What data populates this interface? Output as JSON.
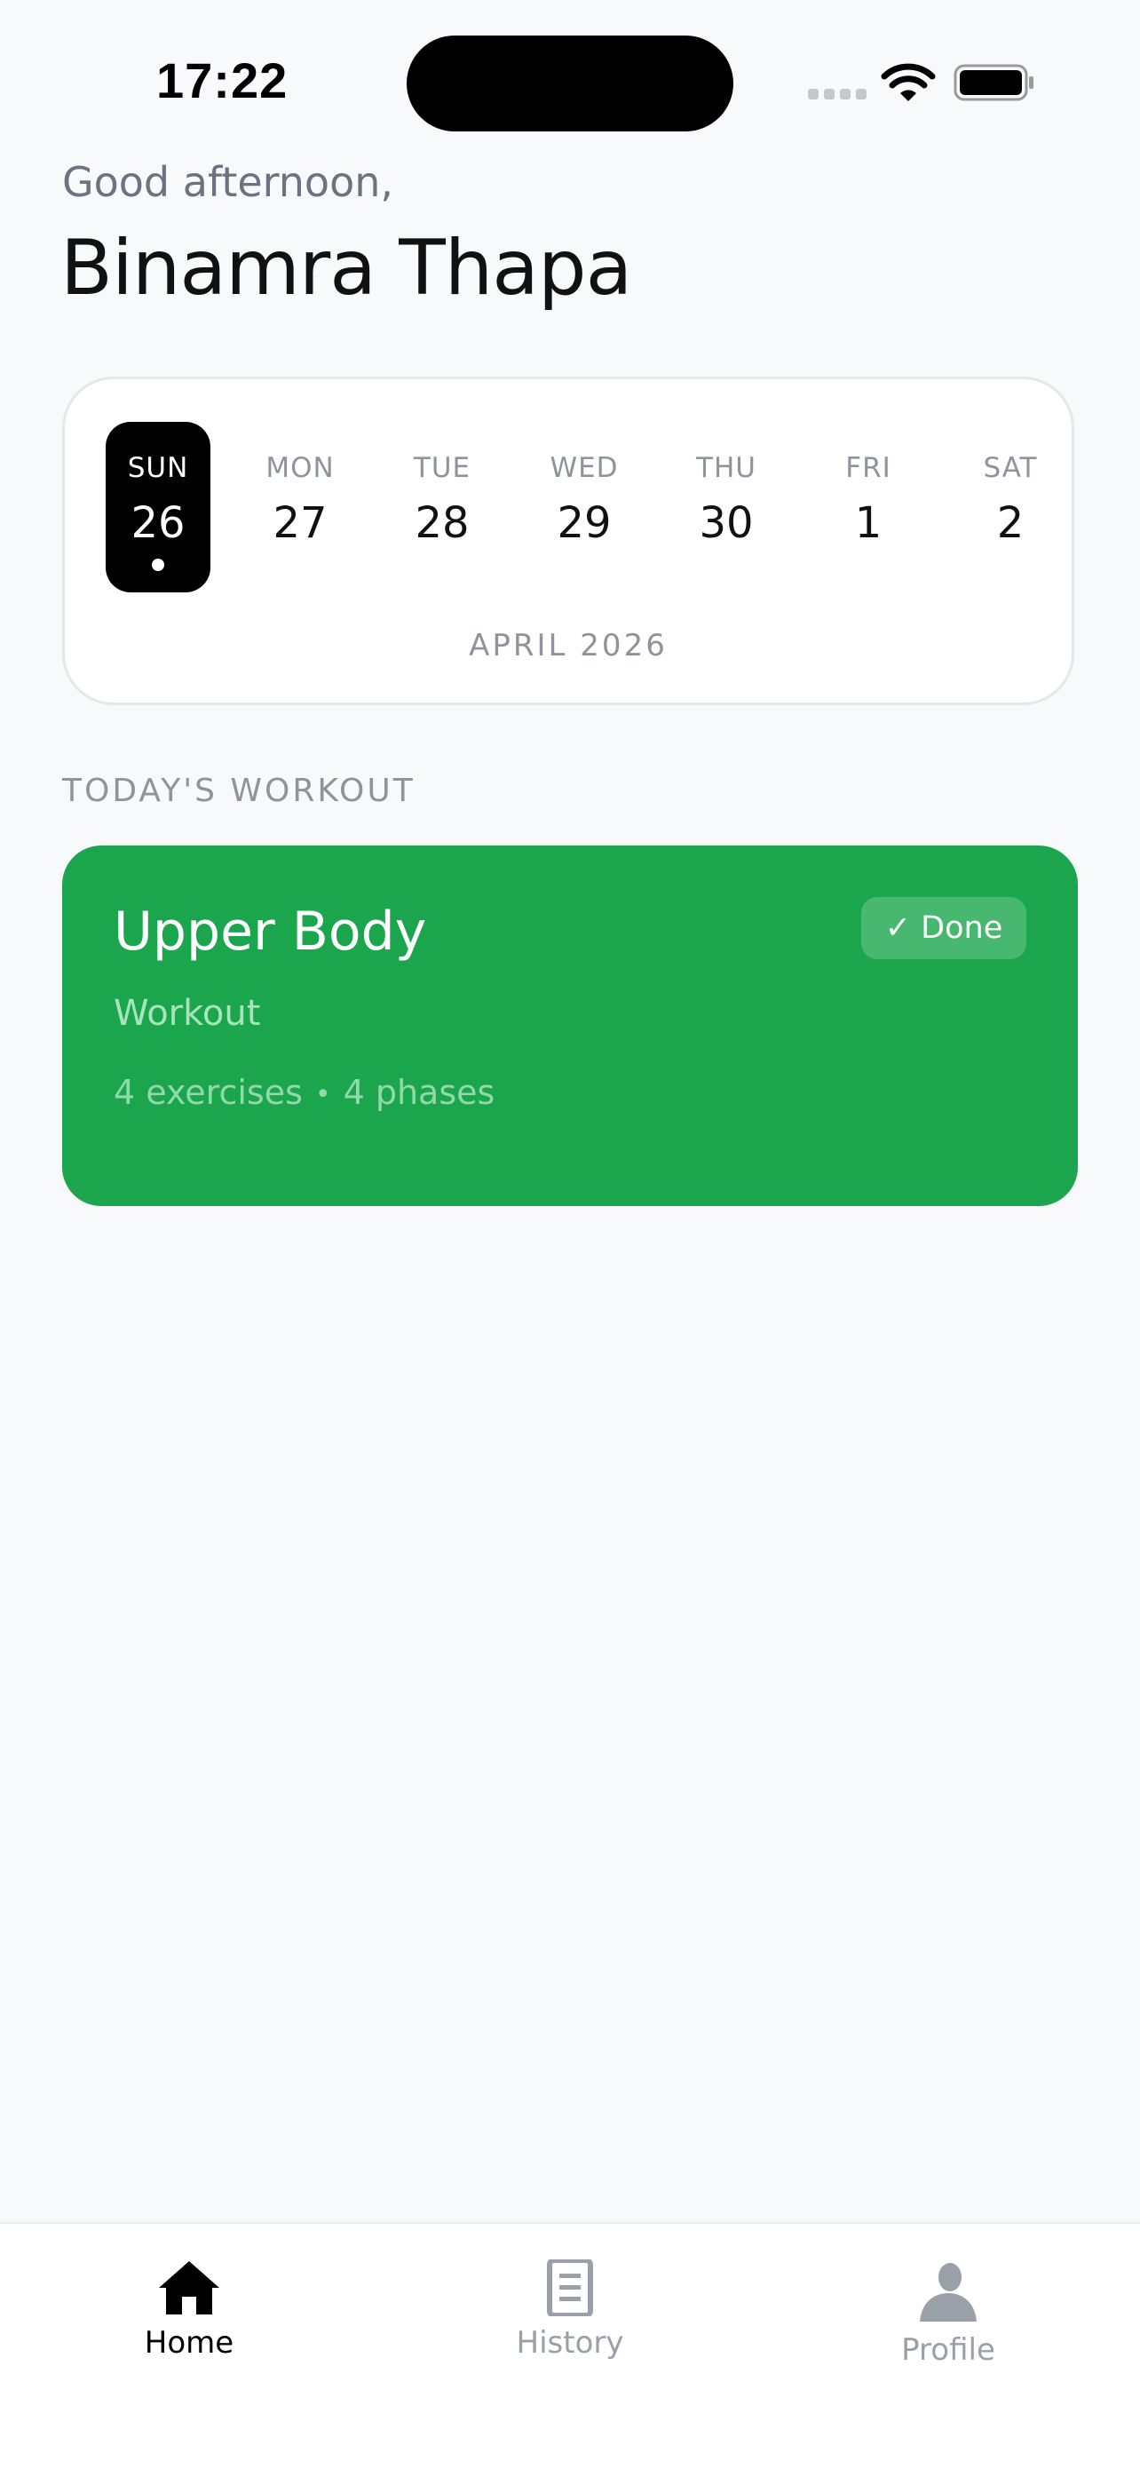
{
  "status_bar": {
    "time": "17:22",
    "icons": [
      "signal-icon",
      "wifi-icon",
      "battery-icon"
    ]
  },
  "header": {
    "greeting": "Good afternoon,",
    "name": "Binamra Thapa"
  },
  "week": {
    "days": [
      {
        "name": "SUN",
        "num": "26",
        "selected": true
      },
      {
        "name": "MON",
        "num": "27"
      },
      {
        "name": "TUE",
        "num": "28"
      },
      {
        "name": "WED",
        "num": "29"
      },
      {
        "name": "THU",
        "num": "30"
      },
      {
        "name": "FRI",
        "num": "1"
      },
      {
        "name": "SAT",
        "num": "2"
      }
    ],
    "month_label": "APRIL 2026"
  },
  "today": {
    "section_title": "TODAY'S WORKOUT",
    "workout": {
      "title": "Upper Body",
      "subtitle": "Workout",
      "exercises": "4 exercises",
      "separator": "•",
      "phases": "4 phases",
      "badge": "✓ Done",
      "color": "#1ba54c"
    }
  },
  "tab_bar": {
    "tabs": [
      {
        "label": "Home",
        "icon": "home-icon",
        "active": true
      },
      {
        "label": "History",
        "icon": "document-icon"
      },
      {
        "label": "Profile",
        "icon": "person-icon"
      }
    ]
  }
}
